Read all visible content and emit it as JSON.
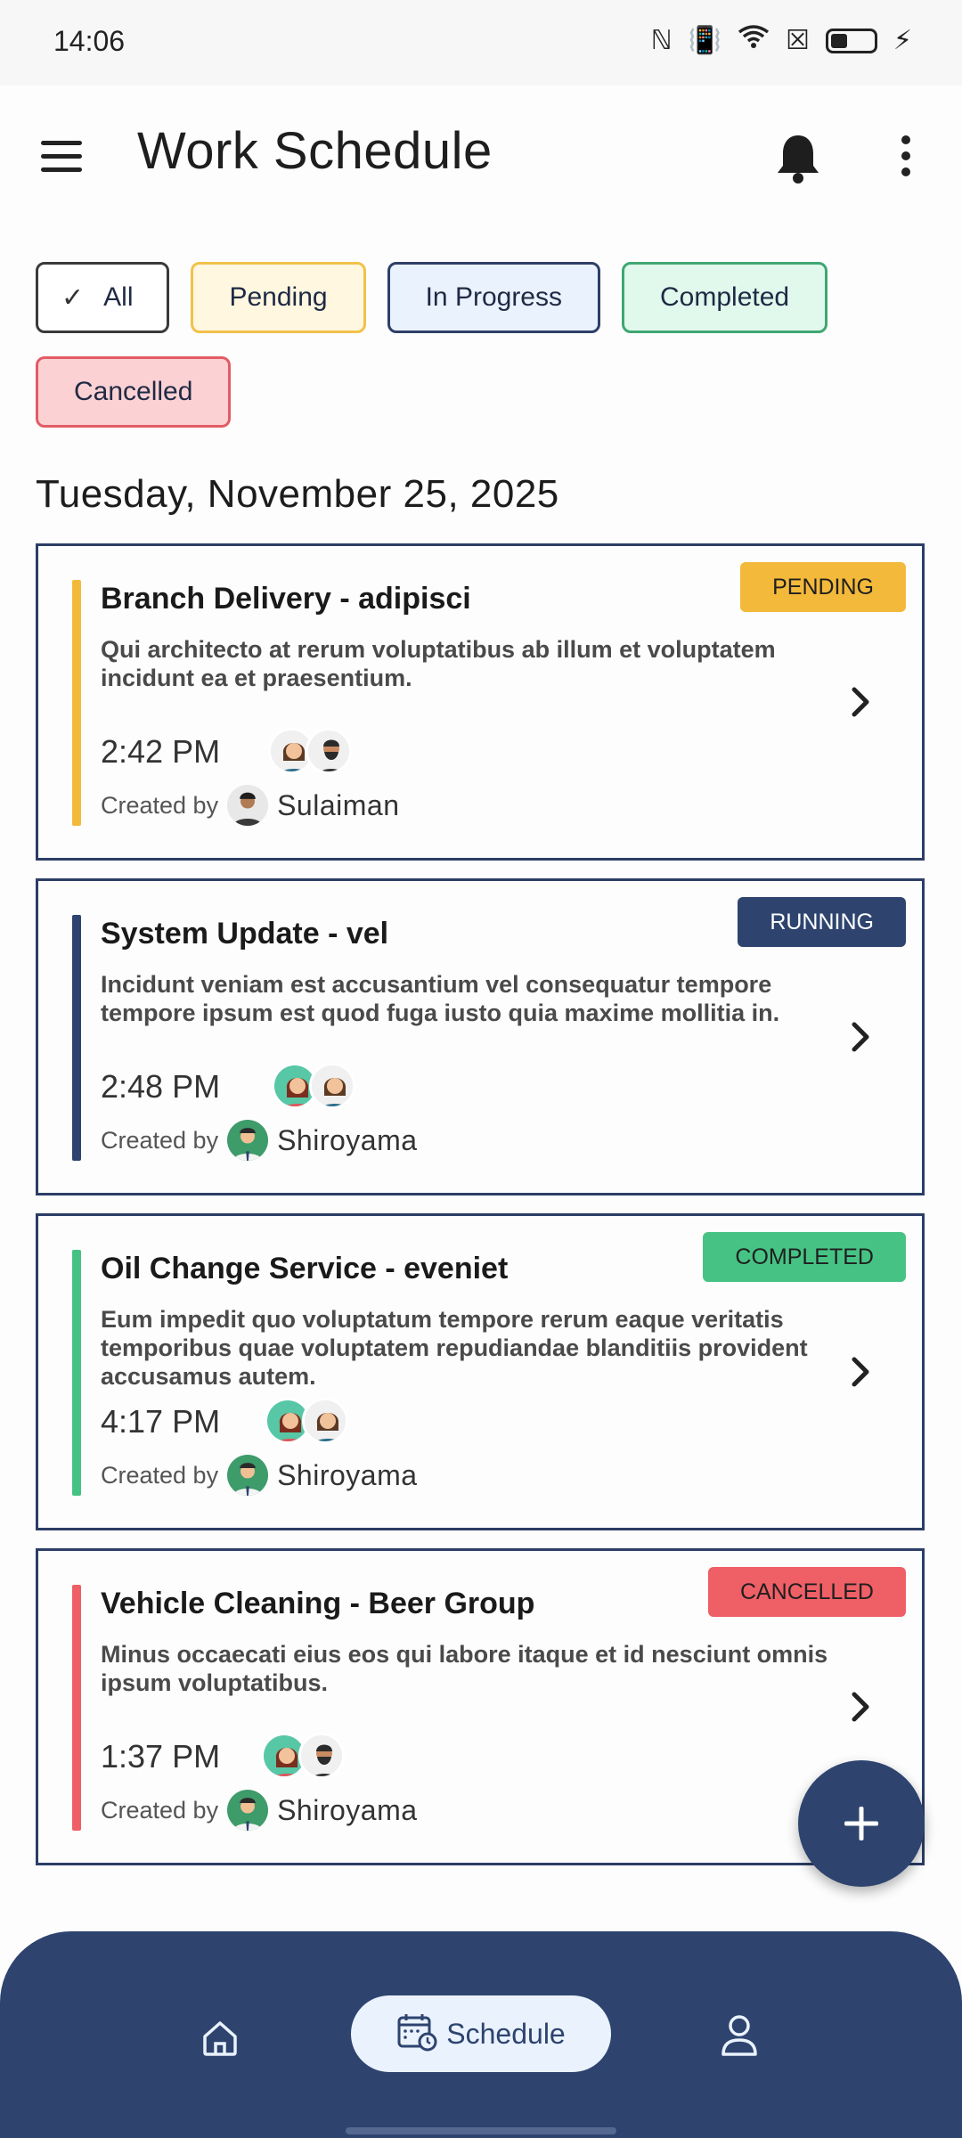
{
  "status_bar": {
    "time": "14:06"
  },
  "app_bar": {
    "title": "Work Schedule"
  },
  "filters": {
    "all": "All",
    "pending": "Pending",
    "in_progress": "In Progress",
    "completed": "Completed",
    "cancelled": "Cancelled",
    "selected": "All"
  },
  "date_heading": "Tuesday, November 25, 2025",
  "colors": {
    "pending": "#F3B93A",
    "running": "#2E446F",
    "completed": "#46C384",
    "cancelled": "#EF5F66",
    "primary": "#2E446F"
  },
  "tasks": [
    {
      "title": "Branch Delivery - adipisci",
      "description": "Qui architecto at rerum voluptatibus ab illum et voluptatem incidunt ea et praesentium.",
      "status": "PENDING",
      "time": "2:42 PM",
      "created_by_label": "Created by",
      "creator": "Sulaiman"
    },
    {
      "title": "System Update - vel",
      "description": "Incidunt veniam est accusantium vel consequatur tempore tempore ipsum est quod fuga iusto quia maxime mollitia in.",
      "status": "RUNNING",
      "time": "2:48 PM",
      "created_by_label": "Created by",
      "creator": "Shiroyama"
    },
    {
      "title": "Oil Change Service - eveniet",
      "description": "Eum impedit quo voluptatum tempore rerum eaque veritatis temporibus quae voluptatem repudiandae blanditiis provident accusamus autem.",
      "status": "COMPLETED",
      "time": "4:17 PM",
      "created_by_label": "Created by",
      "creator": "Shiroyama"
    },
    {
      "title": "Vehicle Cleaning - Beer Group",
      "description": "Minus occaecati eius eos qui labore itaque et id nesciunt omnis ipsum voluptatibus.",
      "status": "CANCELLED",
      "time": "1:37 PM",
      "created_by_label": "Created by",
      "creator": "Shiroyama"
    }
  ],
  "bottom_nav": {
    "schedule": "Schedule",
    "active": "Schedule"
  }
}
